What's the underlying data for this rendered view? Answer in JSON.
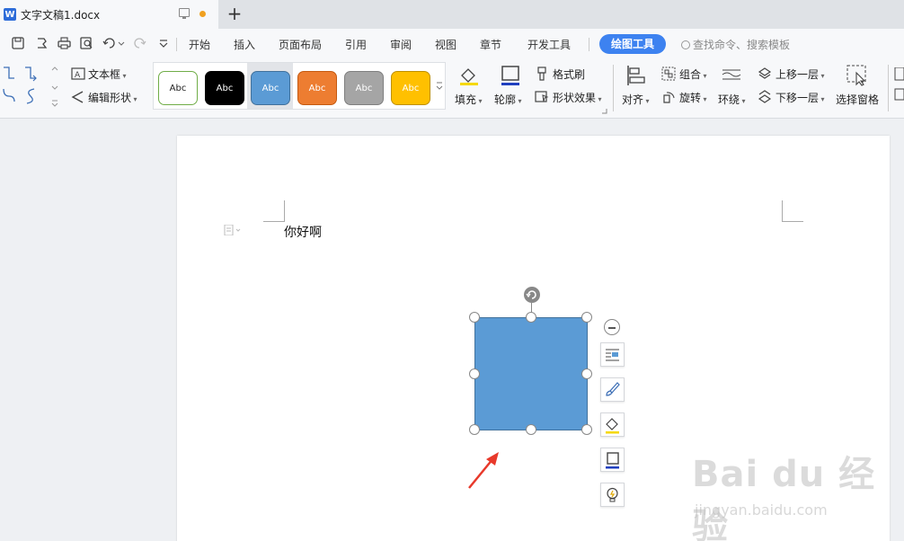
{
  "tab": {
    "title": "文字文稿1.docx",
    "doc_letter": "W",
    "add": "+"
  },
  "menu": {
    "items": [
      "开始",
      "插入",
      "页面布局",
      "引用",
      "审阅",
      "视图",
      "章节",
      "开发工具"
    ],
    "active": "绘图工具",
    "search": "查找命令、搜索模板"
  },
  "ribbon": {
    "textbox": "文本框",
    "edit_shape": "编辑形状",
    "style_label": "Abc",
    "styles": [
      {
        "bg": "#ffffff",
        "border": "#70ad47",
        "fg": "#222222"
      },
      {
        "bg": "#000000",
        "border": "#000000",
        "fg": "#ffffff"
      },
      {
        "bg": "#5b9bd5",
        "border": "#41719c",
        "fg": "#ffffff"
      },
      {
        "bg": "#ed7d31",
        "border": "#c55a11",
        "fg": "#ffffff"
      },
      {
        "bg": "#a5a5a5",
        "border": "#7f7f7f",
        "fg": "#ffffff"
      },
      {
        "bg": "#ffc000",
        "border": "#bf9000",
        "fg": "#ffffff"
      }
    ],
    "fill": "填充",
    "outline": "轮廓",
    "format_painter": "格式刷",
    "shape_effects": "形状效果",
    "align": "对齐",
    "group": "组合",
    "rotate": "旋转",
    "wrap": "环绕",
    "bring_forward": "上移一层",
    "send_backward": "下移一层",
    "selection_pane": "选择窗格"
  },
  "document": {
    "text": "你好啊"
  },
  "shape": {
    "fill": "#5b9bd5",
    "stroke": "#41719c"
  },
  "accent_color": "#3d82f0",
  "arrow_color": "#e8392b",
  "watermark": {
    "main": "Bai du 经验",
    "sub": "jingyan.baidu.com"
  }
}
